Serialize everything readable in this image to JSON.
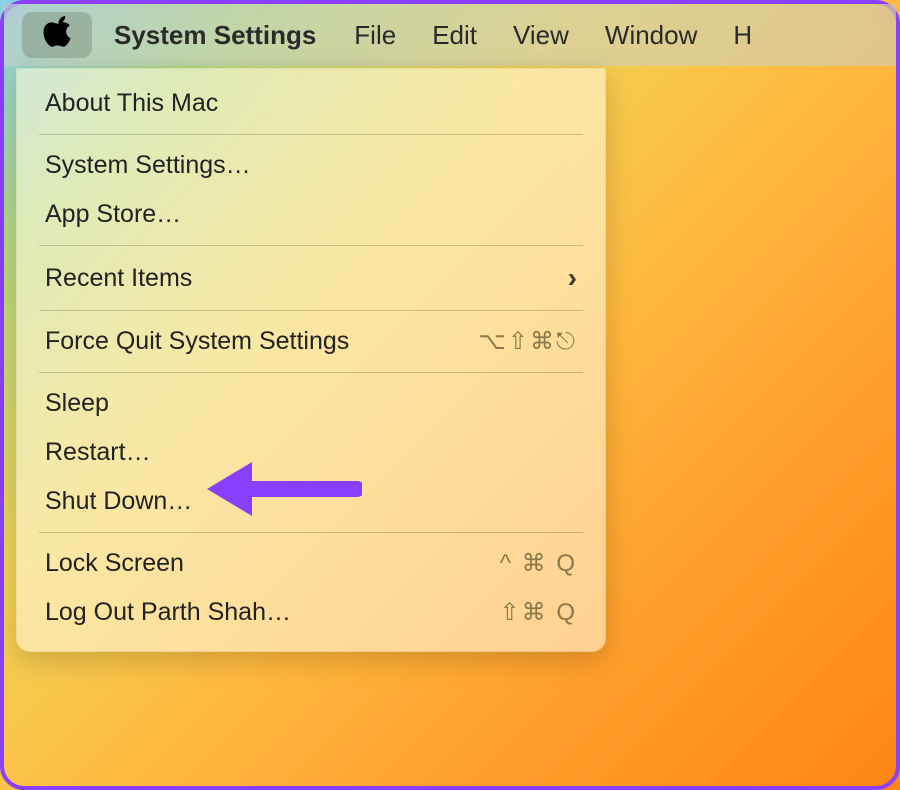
{
  "menubar": {
    "app_name": "System Settings",
    "items": [
      "File",
      "Edit",
      "View",
      "Window",
      "H"
    ]
  },
  "apple_menu": {
    "about": "About This Mac",
    "system_settings": "System Settings…",
    "app_store": "App Store…",
    "recent_items": "Recent Items",
    "force_quit": "Force Quit System Settings",
    "force_quit_shortcut": "⌥⇧⌘⎋",
    "sleep": "Sleep",
    "restart": "Restart…",
    "shutdown": "Shut Down…",
    "lock_screen": "Lock Screen",
    "lock_screen_shortcut": "^ ⌘ Q",
    "log_out": "Log Out Parth Shah…",
    "log_out_shortcut": "⇧⌘ Q"
  }
}
